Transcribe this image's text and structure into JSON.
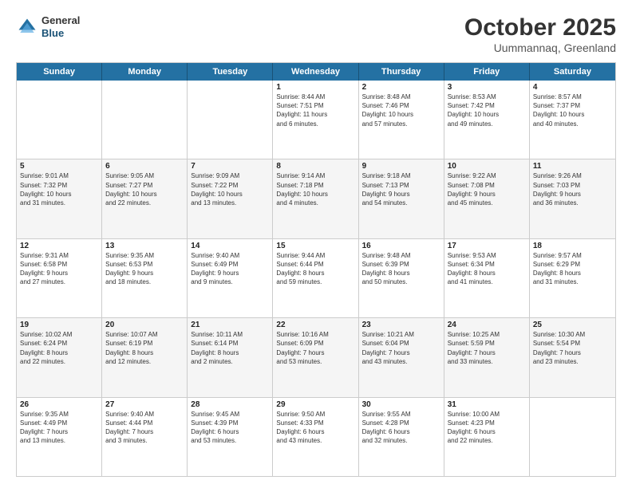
{
  "header": {
    "logo": {
      "general": "General",
      "blue": "Blue"
    },
    "title": "October 2025",
    "location": "Uummannaq, Greenland"
  },
  "weekdays": [
    "Sunday",
    "Monday",
    "Tuesday",
    "Wednesday",
    "Thursday",
    "Friday",
    "Saturday"
  ],
  "rows": [
    [
      {
        "day": "",
        "info": ""
      },
      {
        "day": "",
        "info": ""
      },
      {
        "day": "",
        "info": ""
      },
      {
        "day": "1",
        "info": "Sunrise: 8:44 AM\nSunset: 7:51 PM\nDaylight: 11 hours\nand 6 minutes."
      },
      {
        "day": "2",
        "info": "Sunrise: 8:48 AM\nSunset: 7:46 PM\nDaylight: 10 hours\nand 57 minutes."
      },
      {
        "day": "3",
        "info": "Sunrise: 8:53 AM\nSunset: 7:42 PM\nDaylight: 10 hours\nand 49 minutes."
      },
      {
        "day": "4",
        "info": "Sunrise: 8:57 AM\nSunset: 7:37 PM\nDaylight: 10 hours\nand 40 minutes."
      }
    ],
    [
      {
        "day": "5",
        "info": "Sunrise: 9:01 AM\nSunset: 7:32 PM\nDaylight: 10 hours\nand 31 minutes."
      },
      {
        "day": "6",
        "info": "Sunrise: 9:05 AM\nSunset: 7:27 PM\nDaylight: 10 hours\nand 22 minutes."
      },
      {
        "day": "7",
        "info": "Sunrise: 9:09 AM\nSunset: 7:22 PM\nDaylight: 10 hours\nand 13 minutes."
      },
      {
        "day": "8",
        "info": "Sunrise: 9:14 AM\nSunset: 7:18 PM\nDaylight: 10 hours\nand 4 minutes."
      },
      {
        "day": "9",
        "info": "Sunrise: 9:18 AM\nSunset: 7:13 PM\nDaylight: 9 hours\nand 54 minutes."
      },
      {
        "day": "10",
        "info": "Sunrise: 9:22 AM\nSunset: 7:08 PM\nDaylight: 9 hours\nand 45 minutes."
      },
      {
        "day": "11",
        "info": "Sunrise: 9:26 AM\nSunset: 7:03 PM\nDaylight: 9 hours\nand 36 minutes."
      }
    ],
    [
      {
        "day": "12",
        "info": "Sunrise: 9:31 AM\nSunset: 6:58 PM\nDaylight: 9 hours\nand 27 minutes."
      },
      {
        "day": "13",
        "info": "Sunrise: 9:35 AM\nSunset: 6:53 PM\nDaylight: 9 hours\nand 18 minutes."
      },
      {
        "day": "14",
        "info": "Sunrise: 9:40 AM\nSunset: 6:49 PM\nDaylight: 9 hours\nand 9 minutes."
      },
      {
        "day": "15",
        "info": "Sunrise: 9:44 AM\nSunset: 6:44 PM\nDaylight: 8 hours\nand 59 minutes."
      },
      {
        "day": "16",
        "info": "Sunrise: 9:48 AM\nSunset: 6:39 PM\nDaylight: 8 hours\nand 50 minutes."
      },
      {
        "day": "17",
        "info": "Sunrise: 9:53 AM\nSunset: 6:34 PM\nDaylight: 8 hours\nand 41 minutes."
      },
      {
        "day": "18",
        "info": "Sunrise: 9:57 AM\nSunset: 6:29 PM\nDaylight: 8 hours\nand 31 minutes."
      }
    ],
    [
      {
        "day": "19",
        "info": "Sunrise: 10:02 AM\nSunset: 6:24 PM\nDaylight: 8 hours\nand 22 minutes."
      },
      {
        "day": "20",
        "info": "Sunrise: 10:07 AM\nSunset: 6:19 PM\nDaylight: 8 hours\nand 12 minutes."
      },
      {
        "day": "21",
        "info": "Sunrise: 10:11 AM\nSunset: 6:14 PM\nDaylight: 8 hours\nand 2 minutes."
      },
      {
        "day": "22",
        "info": "Sunrise: 10:16 AM\nSunset: 6:09 PM\nDaylight: 7 hours\nand 53 minutes."
      },
      {
        "day": "23",
        "info": "Sunrise: 10:21 AM\nSunset: 6:04 PM\nDaylight: 7 hours\nand 43 minutes."
      },
      {
        "day": "24",
        "info": "Sunrise: 10:25 AM\nSunset: 5:59 PM\nDaylight: 7 hours\nand 33 minutes."
      },
      {
        "day": "25",
        "info": "Sunrise: 10:30 AM\nSunset: 5:54 PM\nDaylight: 7 hours\nand 23 minutes."
      }
    ],
    [
      {
        "day": "26",
        "info": "Sunrise: 9:35 AM\nSunset: 4:49 PM\nDaylight: 7 hours\nand 13 minutes."
      },
      {
        "day": "27",
        "info": "Sunrise: 9:40 AM\nSunset: 4:44 PM\nDaylight: 7 hours\nand 3 minutes."
      },
      {
        "day": "28",
        "info": "Sunrise: 9:45 AM\nSunset: 4:39 PM\nDaylight: 6 hours\nand 53 minutes."
      },
      {
        "day": "29",
        "info": "Sunrise: 9:50 AM\nSunset: 4:33 PM\nDaylight: 6 hours\nand 43 minutes."
      },
      {
        "day": "30",
        "info": "Sunrise: 9:55 AM\nSunset: 4:28 PM\nDaylight: 6 hours\nand 32 minutes."
      },
      {
        "day": "31",
        "info": "Sunrise: 10:00 AM\nSunset: 4:23 PM\nDaylight: 6 hours\nand 22 minutes."
      },
      {
        "day": "",
        "info": ""
      }
    ]
  ]
}
